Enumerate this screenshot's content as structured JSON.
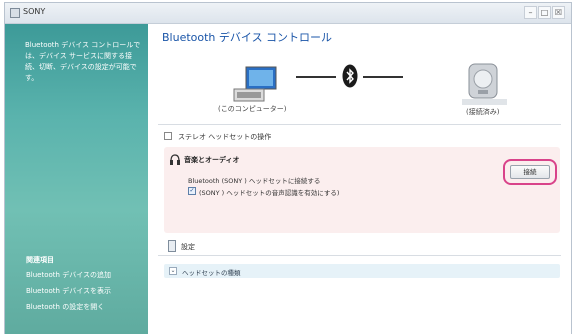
{
  "window": {
    "title": "SONY",
    "controls": {
      "minimize": "–",
      "maximize": "□",
      "close": "☒"
    }
  },
  "sidebar": {
    "description": "Bluetooth デバイス コントロールでは、デバイス サービスに関する接続、切断、デバイスの設定が可能です。",
    "related_heading": "関連項目",
    "links": [
      "Bluetooth デバイスの追加",
      "Bluetooth デバイスを表示",
      "Bluetooth の設定を開く"
    ]
  },
  "main": {
    "title": "Bluetooth デバイス コントロール",
    "pc_label": "(このコンピューター)",
    "device_label": "(接続済み)",
    "stereo_section": "ステレオ ヘッドセットの操作",
    "audio": {
      "title": "音楽とオーディオ",
      "row1": "Bluetooth (SONY          ) ヘッドセットに接続する",
      "row2": "(SONY          ) ヘッドセットの音声認識を有効にする)",
      "connect_label": "接続"
    },
    "settings_section": "設定",
    "headset_type": "ヘッドセットの種類"
  },
  "colors": {
    "accent": "#1a55a8",
    "sidebar": "#5ab3ad",
    "highlight": "#d9438a"
  },
  "icons": [
    "computer-icon",
    "bluetooth-icon",
    "headset-icon",
    "checkbox-icon",
    "chevron-down-icon"
  ]
}
